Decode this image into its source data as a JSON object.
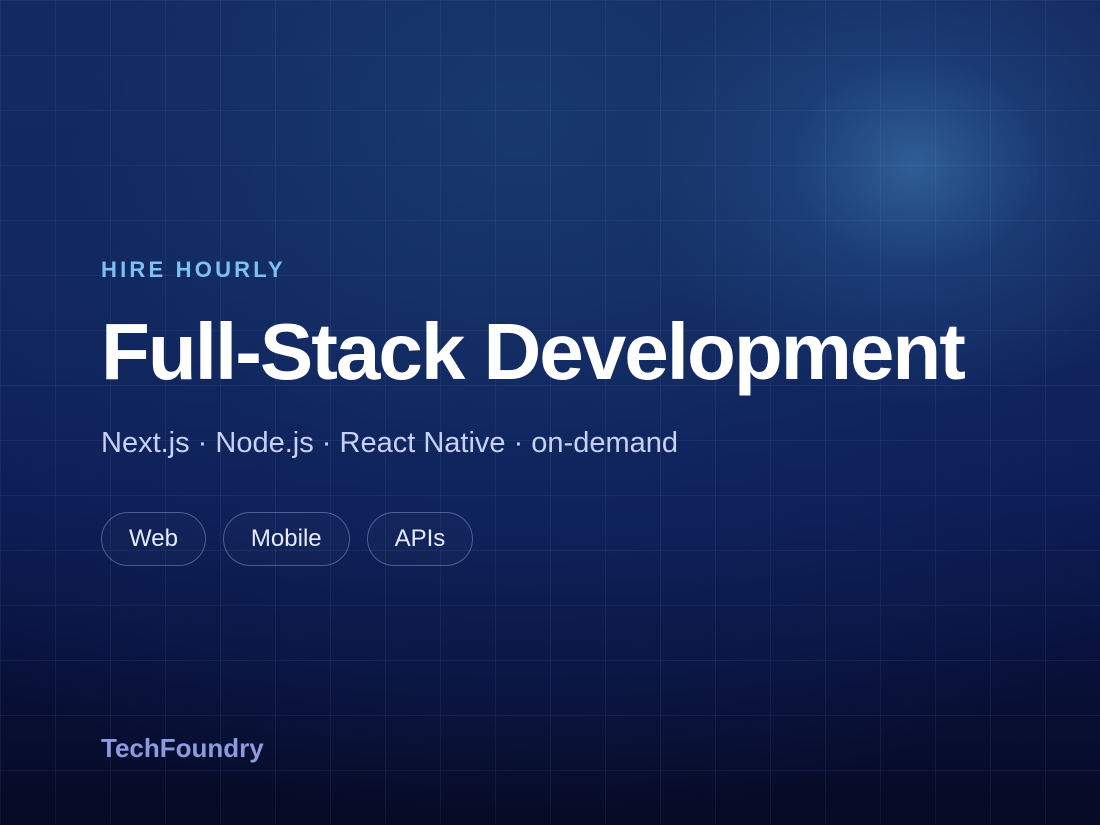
{
  "hero": {
    "eyebrow": "HIRE HOURLY",
    "title": "Full-Stack Development",
    "subtitle": "Next.js · Node.js · React Native · on-demand",
    "tags": [
      "Web",
      "Mobile",
      "APIs"
    ]
  },
  "footer": {
    "brand": "TechFoundry"
  },
  "colors": {
    "eyebrow": "#7cc0f5",
    "title": "#ffffff",
    "subtitle": "#c7d2f2",
    "brand": "#8c9be0",
    "background": "#0a1440"
  }
}
